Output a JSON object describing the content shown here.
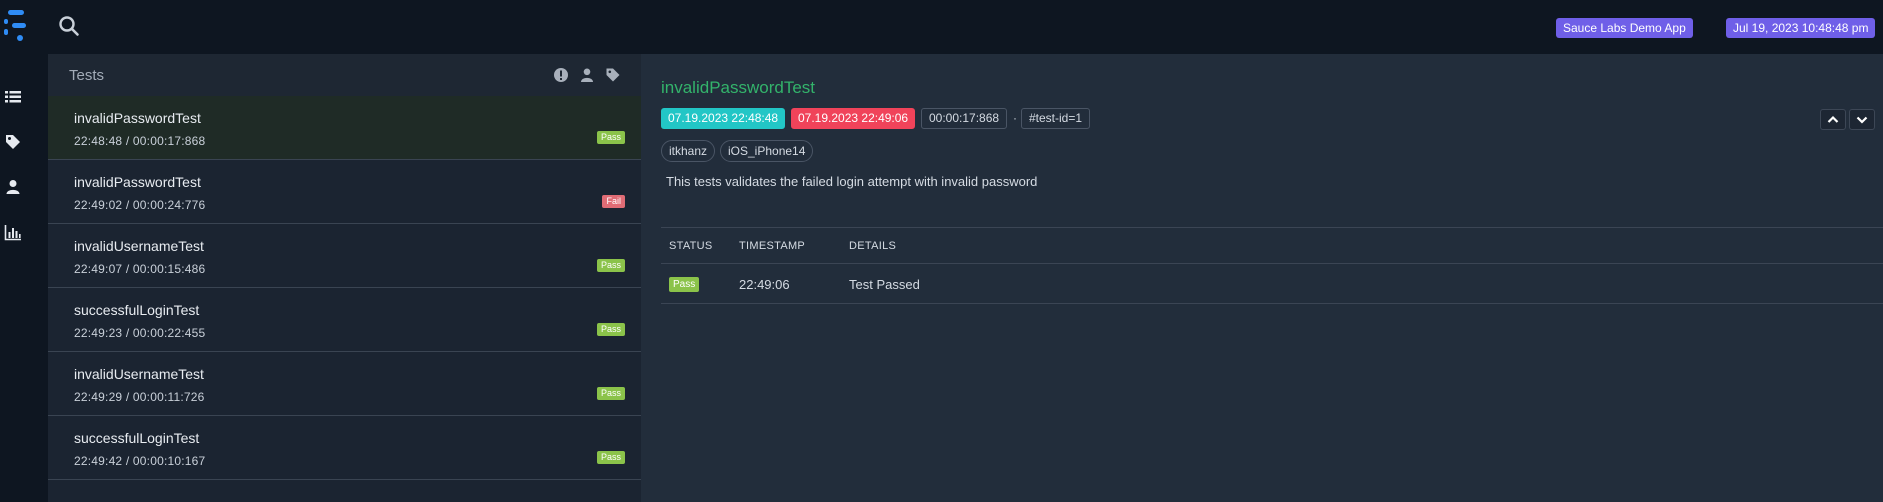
{
  "header": {
    "app_badge": "Sauce Labs Demo App",
    "date_badge": "Jul 19, 2023 10:48:48 pm"
  },
  "tests_panel": {
    "title": "Tests",
    "items": [
      {
        "name": "invalidPasswordTest",
        "meta": "22:48:48 / 00:00:17:868",
        "status": "Pass"
      },
      {
        "name": "invalidPasswordTest",
        "meta": "22:49:02 / 00:00:24:776",
        "status": "Fail"
      },
      {
        "name": "invalidUsernameTest",
        "meta": "22:49:07 / 00:00:15:486",
        "status": "Pass"
      },
      {
        "name": "successfulLoginTest",
        "meta": "22:49:23 / 00:00:22:455",
        "status": "Pass"
      },
      {
        "name": "invalidUsernameTest",
        "meta": "22:49:29 / 00:00:11:726",
        "status": "Pass"
      },
      {
        "name": "successfulLoginTest",
        "meta": "22:49:42 / 00:00:10:167",
        "status": "Pass"
      }
    ]
  },
  "detail": {
    "title": "invalidPasswordTest",
    "start_time": "07.19.2023 22:48:48",
    "end_time": "07.19.2023 22:49:06",
    "duration": "00:00:17:868",
    "separator": "·",
    "test_id": "#test-id=1",
    "author": "itkhanz",
    "device": "iOS_iPhone14",
    "description": "This tests validates the failed login attempt with invalid password",
    "log": {
      "headers": [
        "STATUS",
        "TIMESTAMP",
        "DETAILS"
      ],
      "rows": [
        {
          "status": "Pass",
          "timestamp": "22:49:06",
          "details": "Test Passed"
        }
      ]
    }
  },
  "colors": {
    "accent": "#6f5fe8",
    "pass": "#8bc34a",
    "fail": "#e06c75",
    "start": "#22c6c6",
    "end": "#f0435a",
    "title_green": "#33b36b"
  },
  "icons": {
    "logo": "extent-logo",
    "search": "search-icon",
    "nav": [
      "list-icon",
      "tag-icon",
      "user-icon",
      "bar-chart-icon"
    ],
    "header": [
      "exclamation-icon",
      "user-icon",
      "tag-icon"
    ],
    "arrows": [
      "chevron-up-icon",
      "chevron-down-icon"
    ]
  }
}
